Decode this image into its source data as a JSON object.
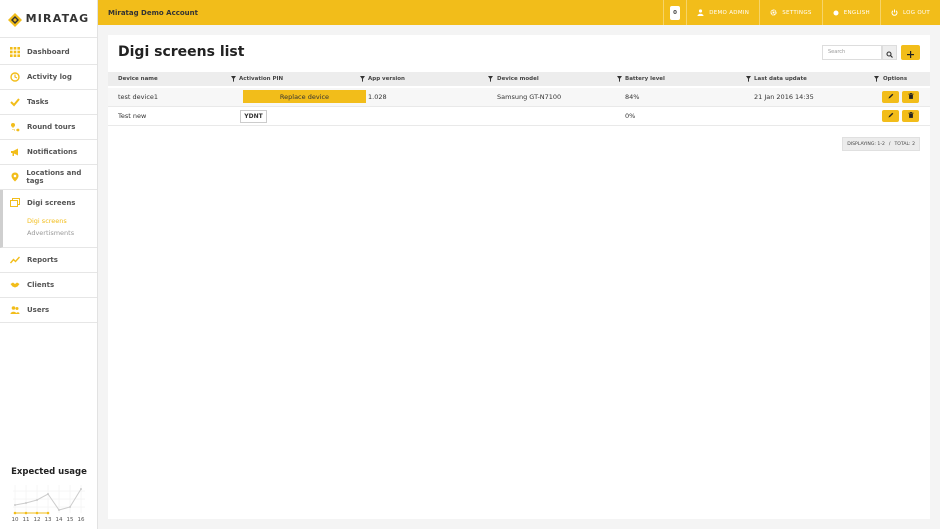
{
  "brand": {
    "name": "MIRATAG"
  },
  "topbar": {
    "account": "Miratag Demo Account",
    "notification_count": "0",
    "user": "DEMO ADMIN",
    "settings": "SETTINGS",
    "language": "ENGLISH",
    "logout": "LOG OUT"
  },
  "sidebar": {
    "items": [
      {
        "label": "Dashboard",
        "icon": "grid-icon"
      },
      {
        "label": "Activity log",
        "icon": "history-icon"
      },
      {
        "label": "Tasks",
        "icon": "check-icon"
      },
      {
        "label": "Round tours",
        "icon": "route-icon"
      },
      {
        "label": "Notifications",
        "icon": "megaphone-icon"
      },
      {
        "label": "Locations and tags",
        "icon": "pin-icon"
      },
      {
        "label": "Digi screens",
        "icon": "screens-icon"
      },
      {
        "label": "Reports",
        "icon": "trend-icon"
      },
      {
        "label": "Clients",
        "icon": "handshake-icon"
      },
      {
        "label": "Users",
        "icon": "users-icon"
      }
    ],
    "digi_subitems": [
      "Digi screens",
      "Advertisments"
    ]
  },
  "usage": {
    "title": "Expected usage",
    "days": [
      "10",
      "11",
      "12",
      "13",
      "14",
      "15",
      "16"
    ]
  },
  "page": {
    "title": "Digi screens list",
    "search_placeholder": "Search"
  },
  "table": {
    "headers": [
      "Device name",
      "Activation PIN",
      "App version",
      "Device model",
      "Battery level",
      "Last data update",
      "Options"
    ],
    "rows": [
      {
        "name": "test device1",
        "pin_action": "Replace device",
        "version": "1.028",
        "model": "Samsung GT-N7100",
        "battery": "84%",
        "updated": "21 Jan 2016 14:35"
      },
      {
        "name": "Test new",
        "pin": "YDNT",
        "version": "",
        "model": "",
        "battery": "0%",
        "updated": ""
      }
    ]
  },
  "pagination": {
    "displaying": "DISPLAYING: 1-2",
    "separator": "/",
    "total": "TOTAL: 2"
  },
  "colors": {
    "accent": "#f2bd1a"
  }
}
